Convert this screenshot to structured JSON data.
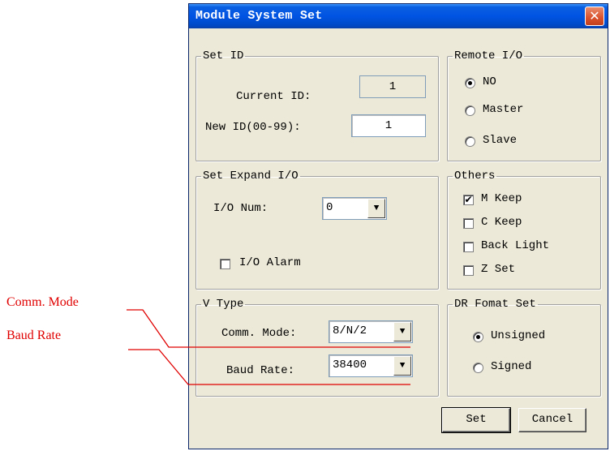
{
  "dialog": {
    "title": "Module System Set",
    "close_icon": "close-icon",
    "close_glyph": "✕"
  },
  "set_id": {
    "legend": "Set ID",
    "current_label": "Current ID:",
    "current_value": "1",
    "new_label": "New ID(00-99):",
    "new_value": "1"
  },
  "remote_io": {
    "legend": "Remote I/O",
    "options": [
      {
        "label": "NO",
        "selected": true
      },
      {
        "label": "Master",
        "selected": false
      },
      {
        "label": "Slave",
        "selected": false
      }
    ]
  },
  "expand_io": {
    "legend": "Set Expand I/O",
    "num_label": "I/O Num:",
    "num_value": "0",
    "alarm_label": "I/O Alarm",
    "alarm_checked": false
  },
  "others": {
    "legend": "Others",
    "items": [
      {
        "label": "M Keep",
        "checked": true
      },
      {
        "label": "C Keep",
        "checked": false
      },
      {
        "label": "Back Light",
        "checked": false
      },
      {
        "label": "Z Set",
        "checked": false
      }
    ]
  },
  "v_type": {
    "legend": "V Type",
    "comm_label": "Comm. Mode:",
    "comm_value": "8/N/2",
    "baud_label": "Baud Rate:",
    "baud_value": "38400"
  },
  "dr_format": {
    "legend": "DR Fomat Set",
    "options": [
      {
        "label": "Unsigned",
        "selected": true
      },
      {
        "label": "Signed",
        "selected": false
      }
    ]
  },
  "buttons": {
    "set": "Set",
    "cancel": "Cancel"
  },
  "annotations": {
    "comm_mode": "Comm. Mode",
    "baud_rate": "Baud Rate",
    "color": "#e00000"
  },
  "colors": {
    "title_bar": "#0054e3",
    "dialog_bg": "#ece9d8",
    "close_button": "#d9512c"
  },
  "icons": {
    "dropdown_arrow": "▼",
    "check_mark": "✔"
  }
}
